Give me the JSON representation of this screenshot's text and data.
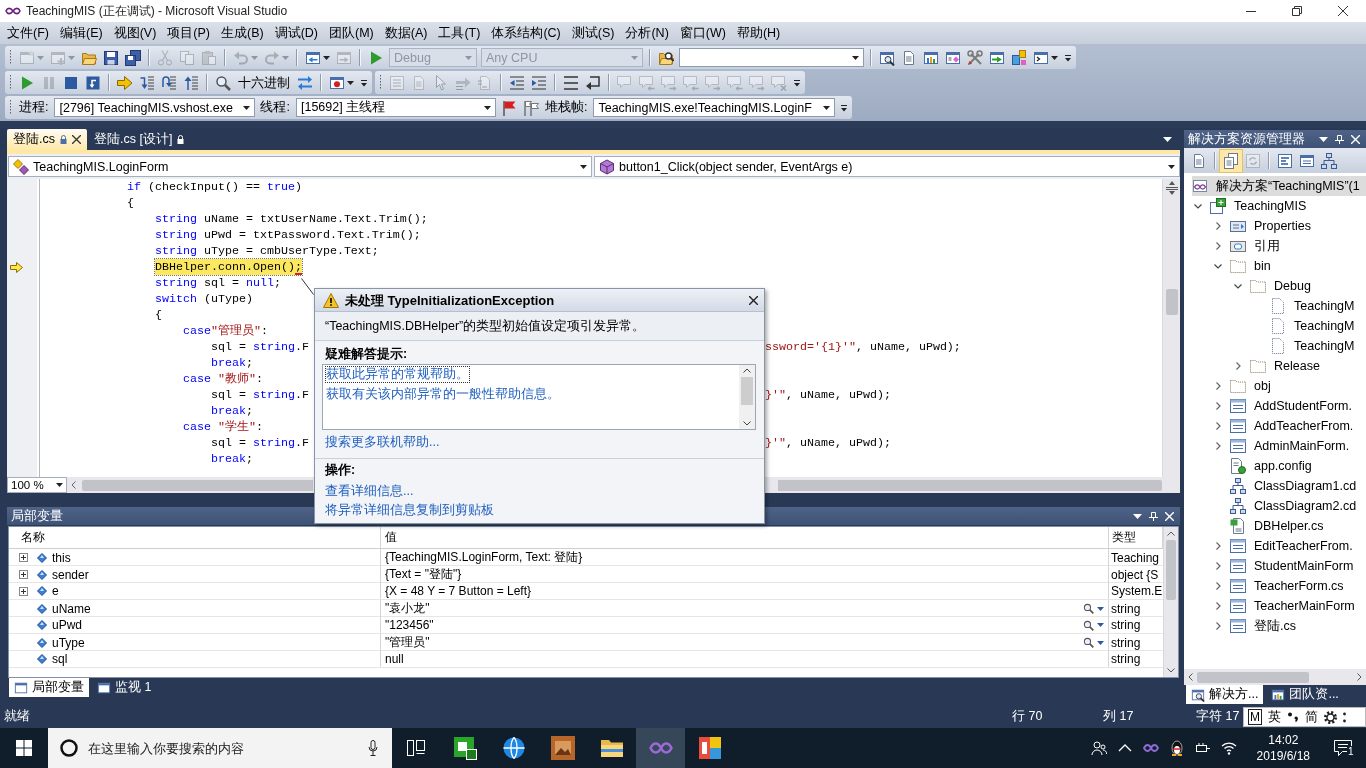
{
  "window": {
    "title": "TeachingMIS (正在调试) - Microsoft Visual Studio"
  },
  "menu": [
    "文件(F)",
    "编辑(E)",
    "视图(V)",
    "项目(P)",
    "生成(B)",
    "调试(D)",
    "团队(M)",
    "数据(A)",
    "工具(T)",
    "体系结构(C)",
    "测试(S)",
    "分析(N)",
    "窗口(W)",
    "帮助(H)"
  ],
  "toolbar_rows": [
    {
      "toolbars": [
        {
          "items": [
            {
              "kind": "new-project",
              "disabled": true,
              "caret": true
            },
            {
              "kind": "add-item",
              "disabled": true,
              "caret": true
            },
            {
              "kind": "open",
              "disabled": false
            },
            {
              "kind": "save",
              "disabled": false
            },
            {
              "kind": "save-all",
              "disabled": false
            },
            {
              "kind": "separator"
            },
            {
              "kind": "cut",
              "disabled": true
            },
            {
              "kind": "copy",
              "disabled": true
            },
            {
              "kind": "paste",
              "disabled": true
            },
            {
              "kind": "separator"
            },
            {
              "kind": "undo",
              "disabled": true,
              "caret": true
            },
            {
              "kind": "redo",
              "disabled": true,
              "caret": true
            },
            {
              "kind": "separator"
            },
            {
              "kind": "navigate",
              "disabled": false,
              "caret": true
            },
            {
              "kind": "navigate-forward",
              "disabled": true
            },
            {
              "kind": "separator"
            },
            {
              "kind": "start",
              "disabled": false
            },
            {
              "kind": "combo",
              "value": "Debug",
              "disabled": true
            },
            {
              "kind": "combo",
              "value": "Any CPU",
              "disabled": true
            },
            {
              "kind": "separator"
            },
            {
              "kind": "find-in-files",
              "disabled": false
            },
            {
              "kind": "combo",
              "disabled": false
            },
            {
              "kind": "separator"
            },
            {
              "kind": "solution-explorer",
              "disabled": false
            },
            {
              "kind": "properties",
              "disabled": false
            },
            {
              "kind": "object-browser",
              "disabled": false
            },
            {
              "kind": "toolbox",
              "disabled": false
            },
            {
              "kind": "tools",
              "disabled": false
            },
            {
              "kind": "start-page",
              "disabled": false
            },
            {
              "kind": "class-view",
              "disabled": false
            },
            {
              "kind": "command-window",
              "disabled": false,
              "caret": true
            }
          ]
        }
      ]
    },
    {
      "toolbars": [
        {
          "items": [
            {
              "kind": "continue",
              "disabled": false
            },
            {
              "kind": "pause",
              "disabled": true
            },
            {
              "kind": "stop",
              "disabled": false
            },
            {
              "kind": "restart",
              "disabled": false
            },
            {
              "kind": "separator"
            },
            {
              "kind": "show-next",
              "disabled": false
            },
            {
              "kind": "step-into",
              "disabled": false
            },
            {
              "kind": "step-over",
              "disabled": false
            },
            {
              "kind": "step-out",
              "disabled": false
            },
            {
              "kind": "separator"
            },
            {
              "kind": "quick-watch",
              "disabled": false
            },
            {
              "kind": "text-button",
              "text": "十六进制",
              "disabled": false
            },
            {
              "kind": "threads",
              "disabled": false
            },
            {
              "kind": "separator"
            },
            {
              "kind": "breakpoints",
              "disabled": false,
              "caret": true
            }
          ]
        },
        {
          "items": [
            {
              "kind": "list-members",
              "disabled": true
            },
            {
              "kind": "parameter-info",
              "disabled": true
            },
            {
              "kind": "quick-info",
              "disabled": true
            },
            {
              "kind": "complete-word",
              "disabled": true
            },
            {
              "kind": "display-word",
              "disabled": true
            },
            {
              "kind": "separator"
            },
            {
              "kind": "outdent",
              "disabled": false
            },
            {
              "kind": "indent",
              "disabled": false
            },
            {
              "kind": "separator"
            },
            {
              "kind": "comment",
              "disabled": false
            },
            {
              "kind": "uncomment",
              "disabled": false
            },
            {
              "kind": "separator"
            },
            {
              "kind": "bookmark",
              "disabled": true
            },
            {
              "kind": "bookmark-prev",
              "disabled": true
            },
            {
              "kind": "bookmark-next",
              "disabled": true
            },
            {
              "kind": "bookmark-prev",
              "disabled": true
            },
            {
              "kind": "bookmark-next",
              "disabled": true
            },
            {
              "kind": "bookmark-prev",
              "disabled": true
            },
            {
              "kind": "bookmark-next",
              "disabled": true
            },
            {
              "kind": "bookmark-clear",
              "disabled": true
            }
          ]
        }
      ]
    },
    {
      "toolbars": [
        {
          "items": [
            {
              "kind": "label",
              "text": "进程:"
            },
            {
              "kind": "combo",
              "value": "[2796] TeachingMIS.vshost.exe",
              "disabled": false
            },
            {
              "kind": "label",
              "text": "线程:"
            },
            {
              "kind": "combo",
              "value": "[15692] 主线程",
              "disabled": false
            },
            {
              "kind": "flag",
              "disabled": false
            },
            {
              "kind": "flag-all",
              "disabled": false
            },
            {
              "kind": "label",
              "text": "堆栈帧:"
            },
            {
              "kind": "combo",
              "value": "TeachingMIS.exe!TeachingMIS.LoginF",
              "disabled": false
            }
          ]
        }
      ]
    }
  ],
  "document_tabs": [
    {
      "label": "登陆.cs",
      "selected": true,
      "locked": true
    },
    {
      "label": "登陆.cs [设计]",
      "selected": false,
      "locked": true
    }
  ],
  "navigation": {
    "type": "TeachingMIS.LoginForm",
    "member": "button1_Click(object sender, EventArgs e)"
  },
  "editor": {
    "lines": [
      {
        "tokens": [
          {
            "kind": "keyword",
            "text": "if"
          },
          {
            "kind": "plain",
            "text": " (checkInput() == "
          },
          {
            "kind": "keyword",
            "text": "true"
          },
          {
            "kind": "plain",
            "text": ")"
          }
        ],
        "current": false
      },
      {
        "tokens": [
          {
            "kind": "plain",
            "text": "{"
          }
        ],
        "current": false
      },
      {
        "children": [
          {
            "tokens": [
              {
                "kind": "keyword",
                "text": "string"
              },
              {
                "kind": "plain",
                "text": " uName = txtUserName.Text.Trim();"
              }
            ],
            "current": false
          },
          {
            "tokens": [
              {
                "kind": "keyword",
                "text": "string"
              },
              {
                "kind": "plain",
                "text": " uPwd = txtPassword.Text.Trim();"
              }
            ],
            "current": false
          },
          {
            "tokens": [
              {
                "kind": "keyword",
                "text": "string"
              },
              {
                "kind": "plain",
                "text": " uType = cmbUserType.Text;"
              }
            ],
            "current": false
          },
          {
            "tokens": [
              {
                "kind": "plain",
                "text": "DBHelper.conn.Open();"
              }
            ],
            "current": true
          },
          {
            "tokens": [
              {
                "kind": "keyword",
                "text": "string"
              },
              {
                "kind": "plain",
                "text": " sql = "
              },
              {
                "kind": "keyword",
                "text": "null"
              },
              {
                "kind": "plain",
                "text": ";"
              }
            ],
            "current": false
          },
          {
            "tokens": [
              {
                "kind": "keyword",
                "text": "switch"
              },
              {
                "kind": "plain",
                "text": " (uType)"
              }
            ],
            "current": false
          },
          {
            "tokens": [
              {
                "kind": "plain",
                "text": "{"
              }
            ],
            "current": false
          },
          {
            "children": [
              {
                "tokens": [
                  {
                    "kind": "keyword",
                    "text": "case"
                  },
                  {
                    "kind": "string",
                    "text": "\"管理员\""
                  },
                  {
                    "kind": "plain",
                    "text": ":"
                  }
                ],
                "current": false
              },
              {
                "children": [
                  {
                    "tokens": [
                      {
                        "kind": "plain",
                        "text": "sql = "
                      },
                      {
                        "kind": "keyword",
                        "text": "string"
                      },
                      {
                        "kind": "plain",
                        "text": ".F"
                      }
                    ],
                    "tail": [
                      {
                        "kind": "string",
                        "text": "ssword='{1}'\""
                      },
                      {
                        "kind": "plain",
                        "text": ", uName, uPwd);"
                      }
                    ],
                    "current": false
                  },
                  {
                    "tokens": [
                      {
                        "kind": "keyword",
                        "text": "break"
                      },
                      {
                        "kind": "plain",
                        "text": ";"
                      }
                    ],
                    "current": false
                  }
                ]
              },
              {
                "tokens": [
                  {
                    "kind": "keyword",
                    "text": "case"
                  },
                  {
                    "kind": "string",
                    "text": " \"教师\""
                  },
                  {
                    "kind": "plain",
                    "text": ":"
                  }
                ],
                "current": false
              },
              {
                "children": [
                  {
                    "tokens": [
                      {
                        "kind": "plain",
                        "text": "sql = "
                      },
                      {
                        "kind": "keyword",
                        "text": "string"
                      },
                      {
                        "kind": "plain",
                        "text": ".F"
                      }
                    ],
                    "tail": [
                      {
                        "kind": "string",
                        "text": "}'\""
                      },
                      {
                        "kind": "plain",
                        "text": ", uName, uPwd);"
                      }
                    ],
                    "current": false
                  },
                  {
                    "tokens": [
                      {
                        "kind": "keyword",
                        "text": "break"
                      },
                      {
                        "kind": "plain",
                        "text": ";"
                      }
                    ],
                    "current": false
                  }
                ]
              },
              {
                "tokens": [
                  {
                    "kind": "keyword",
                    "text": "case"
                  },
                  {
                    "kind": "string",
                    "text": " \"学生\""
                  },
                  {
                    "kind": "plain",
                    "text": ":"
                  }
                ],
                "current": false
              },
              {
                "children": [
                  {
                    "tokens": [
                      {
                        "kind": "plain",
                        "text": "sql = "
                      },
                      {
                        "kind": "keyword",
                        "text": "string"
                      },
                      {
                        "kind": "plain",
                        "text": ".F"
                      }
                    ],
                    "tail": [
                      {
                        "kind": "string",
                        "text": "}'\""
                      },
                      {
                        "kind": "plain",
                        "text": ", uName, uPwd);"
                      }
                    ],
                    "current": false
                  },
                  {
                    "tokens": [
                      {
                        "kind": "keyword",
                        "text": "break"
                      },
                      {
                        "kind": "plain",
                        "text": ";"
                      }
                    ],
                    "current": false
                  }
                ]
              }
            ]
          }
        ]
      }
    ],
    "zoom": "100 %"
  },
  "exception": {
    "title": "未处理 TypeInitializationException",
    "message": "“TeachingMIS.DBHelper”的类型初始值设定项引发异常。",
    "tips_heading": "疑难解答提示:",
    "tips": [
      {
        "text": "获取此异常的常规帮助。",
        "selected": true
      },
      {
        "text": "获取有关该内部异常的一般性帮助信息。",
        "selected": false
      }
    ],
    "search_link": "搜索更多联机帮助...",
    "actions_heading": "操作:",
    "actions": [
      "查看详细信息...",
      "将异常详细信息复制到剪贴板"
    ]
  },
  "locals": {
    "title": "局部变量",
    "columns": [
      "名称",
      "值",
      "类型"
    ],
    "rows": [
      {
        "name": "this",
        "value": "{TeachingMIS.LoginForm, Text: 登陆}",
        "type": "Teaching",
        "kind": "object"
      },
      {
        "name": "sender",
        "value": "{Text = \"登陆\"}",
        "type": "object {S",
        "kind": "object"
      },
      {
        "name": "e",
        "value": "{X = 48 Y = 7 Button = Left}",
        "type": "System.E",
        "kind": "object"
      },
      {
        "name": "uName",
        "value": "\"袁小龙\"",
        "type": "string",
        "kind": "text"
      },
      {
        "name": "uPwd",
        "value": "\"123456\"",
        "type": "string",
        "kind": "text"
      },
      {
        "name": "uType",
        "value": "\"管理员\"",
        "type": "string",
        "kind": "text"
      },
      {
        "name": "sql",
        "value": "null",
        "type": "string",
        "kind": "plain"
      }
    ]
  },
  "bottom_tabs": [
    {
      "label": "局部变量",
      "selected": true
    },
    {
      "label": "监视 1",
      "selected": false
    }
  ],
  "solution_explorer": {
    "title": "解决方案资源管理器",
    "toolbar": [
      {
        "kind": "properties",
        "pressed": false,
        "disabled": false
      },
      {
        "kind": "separator"
      },
      {
        "kind": "show-all-files",
        "pressed": true,
        "disabled": false
      },
      {
        "kind": "refresh",
        "pressed": false,
        "disabled": true
      },
      {
        "kind": "separator"
      },
      {
        "kind": "view-code",
        "pressed": false,
        "disabled": false
      },
      {
        "kind": "view-designer",
        "pressed": false,
        "disabled": false
      },
      {
        "kind": "class-diagram",
        "pressed": false,
        "disabled": false
      }
    ],
    "tree": [
      {
        "label": "解决方案“TeachingMIS”(1",
        "kind": "solution",
        "selected": true,
        "children": [
          {
            "label": "TeachingMIS",
            "kind": "project",
            "expanded": true,
            "selected": false,
            "children": [
              {
                "label": "Properties",
                "kind": "properties",
                "expanded": false,
                "selected": false
              },
              {
                "label": "引用",
                "kind": "references",
                "expanded": false,
                "selected": false
              },
              {
                "label": "bin",
                "kind": "folder",
                "expanded": true,
                "selected": false,
                "children": [
                  {
                    "label": "Debug",
                    "kind": "folder",
                    "expanded": true,
                    "selected": false,
                    "children": [
                      {
                        "label": "TeachingM",
                        "kind": "file",
                        "selected": false
                      },
                      {
                        "label": "TeachingM",
                        "kind": "file",
                        "selected": false
                      },
                      {
                        "label": "TeachingM",
                        "kind": "file",
                        "selected": false
                      }
                    ]
                  },
                  {
                    "label": "Release",
                    "kind": "folder",
                    "expanded": false,
                    "selected": false
                  }
                ]
              },
              {
                "label": "obj",
                "kind": "folder",
                "expanded": false,
                "selected": false
              },
              {
                "label": "AddStudentForm.",
                "kind": "form",
                "expanded": false,
                "selected": false
              },
              {
                "label": "AddTeacherFrom.",
                "kind": "form",
                "expanded": false,
                "selected": false
              },
              {
                "label": "AdminMainForm.",
                "kind": "form",
                "expanded": false,
                "selected": false
              },
              {
                "label": "app.config",
                "kind": "config",
                "selected": false
              },
              {
                "label": "ClassDiagram1.cd",
                "kind": "diagram",
                "selected": false
              },
              {
                "label": "ClassDiagram2.cd",
                "kind": "diagram",
                "selected": false
              },
              {
                "label": "DBHelper.cs",
                "kind": "code",
                "selected": false
              },
              {
                "label": "EditTeacherFrom.",
                "kind": "form",
                "expanded": false,
                "selected": false
              },
              {
                "label": "StudentMainForm",
                "kind": "form",
                "expanded": false,
                "selected": false
              },
              {
                "label": "TeacherForm.cs",
                "kind": "form",
                "expanded": false,
                "selected": false
              },
              {
                "label": "TeacherMainForm",
                "kind": "form",
                "expanded": false,
                "selected": false
              },
              {
                "label": "登陆.cs",
                "kind": "form",
                "expanded": false,
                "selected": false
              }
            ]
          }
        ]
      }
    ],
    "tabs": [
      {
        "label": "解决方...",
        "selected": true
      },
      {
        "label": "团队资...",
        "selected": false
      }
    ]
  },
  "status_bar": {
    "message": "就绪",
    "line": "行 70",
    "column": "列 17",
    "character": "字符 17"
  },
  "ime": [
    {
      "kind": "logo",
      "text": "M"
    },
    {
      "kind": "text",
      "text": "英"
    },
    {
      "kind": "punctuation"
    },
    {
      "kind": "text",
      "text": "简"
    },
    {
      "kind": "settings"
    },
    {
      "kind": "more"
    }
  ],
  "taskbar": {
    "search_placeholder": "在这里输入你要搜索的内容",
    "apps": [
      {
        "kind": "tile-badge",
        "selected": false
      },
      {
        "kind": "browser",
        "selected": false
      },
      {
        "kind": "image",
        "selected": false
      },
      {
        "kind": "folder",
        "selected": false
      },
      {
        "kind": "infinity",
        "selected": true
      },
      {
        "kind": "tiles",
        "selected": false
      }
    ],
    "time": "14:02",
    "date": "2019/6/18",
    "notification_count": "1"
  }
}
